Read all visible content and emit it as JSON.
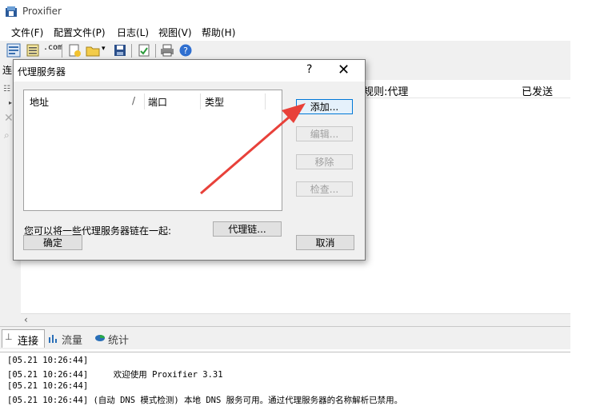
{
  "app": {
    "title": "Proxifier"
  },
  "menu": [
    {
      "label": "文件(F)"
    },
    {
      "label": "配置文件(P)"
    },
    {
      "label": "日志(L)"
    },
    {
      "label": "视图(V)"
    },
    {
      "label": "帮助(H)"
    }
  ],
  "toolbar": {
    "com_label": ".com"
  },
  "main": {
    "left_label": "连",
    "columns": {
      "rule": "规则:代理",
      "sent": "已发送"
    }
  },
  "tabs": [
    {
      "label": "连接"
    },
    {
      "label": "流量"
    },
    {
      "label": "统计"
    }
  ],
  "log": [
    "[05.21 10:26:44]",
    "[05.21 10:26:44]     欢迎使用 Proxifier 3.31",
    "[05.21 10:26:44]",
    "[05.21 10:26:44] (自动 DNS 模式检测) 本地 DNS 服务可用。通过代理服务器的名称解析已禁用。"
  ],
  "dialog": {
    "title": "代理服务器",
    "help_symbol": "?",
    "close_symbol": "✕",
    "list_headers": {
      "address": "地址",
      "sort_mark": "/",
      "port": "端口",
      "type": "类型"
    },
    "buttons": {
      "add": "添加...",
      "edit": "编辑...",
      "remove": "移除",
      "check": "检查...",
      "chain": "代理链...",
      "ok": "确定",
      "cancel": "取消"
    },
    "chain_text": "您可以将一些代理服务器链在一起:"
  },
  "colors": {
    "arrow": "#e8413a",
    "focus_border": "#0078d7"
  }
}
